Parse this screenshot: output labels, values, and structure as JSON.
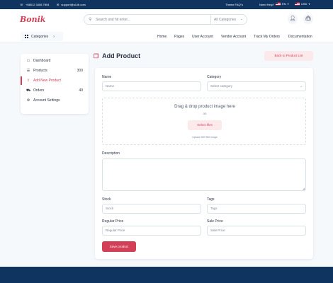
{
  "topbar": {
    "phone": "+88012 3456 7894",
    "email": "support@ui-lib.com",
    "faq": "Theme FAQ\"s",
    "help": "Need Help?",
    "language": "EN",
    "currency": "USD"
  },
  "header": {
    "logo": "Bonik",
    "search_placeholder": "Search and hit enter...",
    "category_select": "All Categories"
  },
  "nav": {
    "categories_label": "Categories",
    "links": [
      "Home",
      "Pages",
      "User Account",
      "Vendor Account",
      "Track My Orders",
      "Documentation"
    ]
  },
  "sidebar": {
    "items": [
      {
        "label": "Dashboard",
        "icon": "dashboard-icon",
        "count": ""
      },
      {
        "label": "Products",
        "icon": "products-icon",
        "count": "300"
      },
      {
        "label": "Add New Product",
        "icon": "upload-icon",
        "count": ""
      },
      {
        "label": "Orders",
        "icon": "cart-icon",
        "count": "40"
      },
      {
        "label": "Account Settings",
        "icon": "gear-icon",
        "count": ""
      }
    ]
  },
  "page": {
    "title": "Add Product",
    "back_button": "Back to Product List"
  },
  "form": {
    "name_label": "Name",
    "name_placeholder": "Name",
    "category_label": "Category",
    "category_placeholder": "Select category",
    "dropzone_title": "Drag & drop product image here",
    "dropzone_or": "on",
    "select_files": "Select files",
    "upload_note": "Upload 280*280 image",
    "description_label": "Description",
    "stock_label": "Stock",
    "stock_placeholder": "Stock",
    "tags_label": "Tags",
    "tags_placeholder": "Tags",
    "regular_price_label": "Regular Price",
    "regular_price_placeholder": "Regular Price",
    "sale_price_label": "Sale Price",
    "sale_price_placeholder": "Sale Price",
    "save_button": "Save product"
  },
  "colors": {
    "brand": "#d23f57",
    "navy": "#0f3460",
    "background": "#f6f9fc"
  }
}
